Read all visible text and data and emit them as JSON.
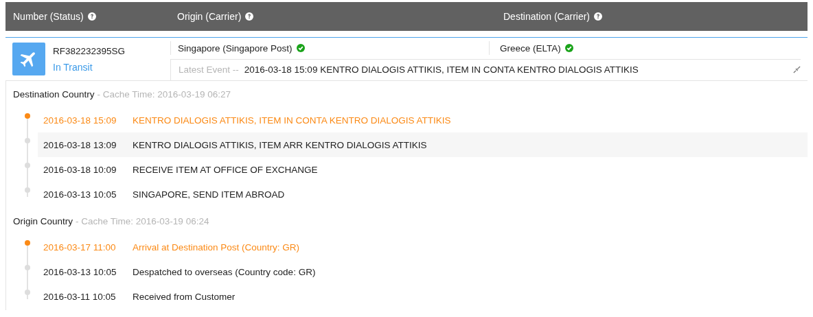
{
  "header": {
    "columns": [
      "Number (Status)",
      "Origin (Carrier)",
      "Destination (Carrier)"
    ]
  },
  "shipment": {
    "number": "RF382232395SG",
    "status": "In Transit",
    "origin": {
      "text": "Singapore (Singapore Post)",
      "verified": true
    },
    "destination": {
      "text": "Greece (ELTA)",
      "verified": true
    },
    "latest_event_label": "Latest Event --",
    "latest_event": "2016-03-18 15:09 KENTRO DIALOGIS ATTIKIS, ITEM IN CONTA KENTRO DIALOGIS ATTIKIS"
  },
  "sections": [
    {
      "title": "Destination Country",
      "cache_time": "- Cache Time: 2016-03-19 06:27",
      "events": [
        {
          "time": "2016-03-18 15:09",
          "text": "KENTRO DIALOGIS ATTIKIS, ITEM IN CONTA KENTRO DIALOGIS ATTIKIS",
          "latest": true,
          "highlighted": false
        },
        {
          "time": "2016-03-18 13:09",
          "text": "KENTRO DIALOGIS ATTIKIS, ITEM ARR KENTRO DIALOGIS ATTIKIS",
          "latest": false,
          "highlighted": true
        },
        {
          "time": "2016-03-18 10:09",
          "text": "RECEIVE ITEM AT OFFICE OF EXCHANGE",
          "latest": false,
          "highlighted": false
        },
        {
          "time": "2016-03-13 10:05",
          "text": "SINGAPORE, SEND ITEM ABROAD",
          "latest": false,
          "highlighted": false
        }
      ]
    },
    {
      "title": "Origin Country",
      "cache_time": "- Cache Time: 2016-03-19 06:24",
      "events": [
        {
          "time": "2016-03-17 11:00",
          "text": "Arrival at Destination Post (Country: GR)",
          "latest": true,
          "highlighted": false
        },
        {
          "time": "2016-03-13 10:05",
          "text": "Despatched to overseas (Country code: GR)",
          "latest": false,
          "highlighted": false
        },
        {
          "time": "2016-03-11 10:05",
          "text": "Received from Customer",
          "latest": false,
          "highlighted": false
        }
      ]
    }
  ]
}
